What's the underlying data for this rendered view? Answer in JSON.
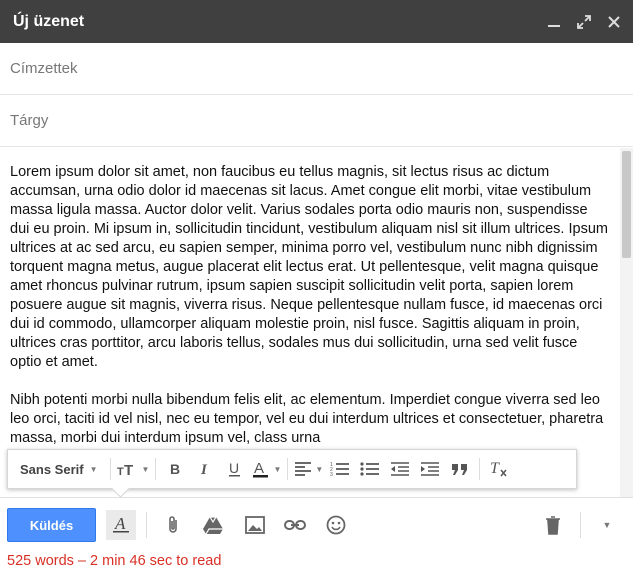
{
  "window": {
    "title": "Új üzenet"
  },
  "fields": {
    "to_placeholder": "Címzettek",
    "subject_placeholder": "Tárgy"
  },
  "body": {
    "paragraphs": [
      "Lorem ipsum dolor sit amet, non faucibus eu tellus magnis, sit lectus risus ac dictum accumsan, urna odio dolor id maecenas sit lacus. Amet congue elit morbi, vitae vestibulum massa ligula massa. Auctor dolor velit. Varius sodales porta odio mauris non, suspendisse dui eu proin. Mi ipsum in, sollicitudin tincidunt, vestibulum aliquam nisl sit illum ultrices. Ipsum ultrices at ac sed arcu, eu sapien semper, minima porro vel, vestibulum nunc nibh dignissim torquent magna metus, augue placerat elit lectus erat. Ut pellentesque, velit magna quisque amet rhoncus pulvinar rutrum, ipsum sapien suscipit sollicitudin velit porta, sapien lorem posuere augue sit magnis, viverra risus. Neque pellentesque nullam fusce, id maecenas orci dui id commodo, ullamcorper aliquam molestie proin, nisl fusce. Sagittis aliquam in proin, ultrices cras porttitor, arcu laboris tellus, sodales mus dui sollicitudin, urna sed velit fusce optio et amet.",
      "Nibh potenti morbi nulla bibendum felis elit, ac elementum. Imperdiet congue viverra sed leo leo orci, taciti id vel nisl, nec eu tempor, vel eu dui interdum ultrices et consectetuer, pharetra massa, morbi dui interdum ipsum vel, class urna"
    ]
  },
  "format_toolbar": {
    "font_family": "Sans Serif"
  },
  "bottom": {
    "send_label": "Küldés",
    "word_count": "525 words – 2 min 46 sec to read"
  },
  "colors": {
    "titlebar": "#404040",
    "send": "#4d90fe",
    "word_count": "#d93025"
  }
}
